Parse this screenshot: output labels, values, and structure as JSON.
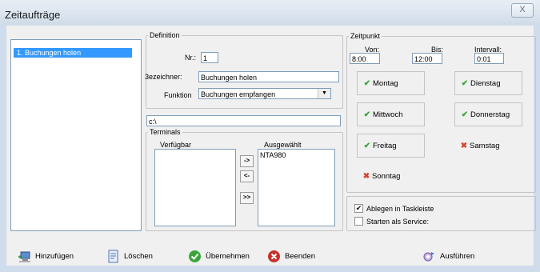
{
  "window": {
    "title": "Zeitaufträge",
    "close_label": "X"
  },
  "jobs_list": {
    "items": [
      "1. Buchungen holen"
    ]
  },
  "definition": {
    "legend": "Definition",
    "nr_label": "Nr.:",
    "nr_value": "1",
    "bezeichner_label": "3ezeichner:",
    "bezeichner_value": "Buchungen holen",
    "funktion_label": "Funktion",
    "funktion_value": "Buchungen empfangen",
    "combo_arrow": "▼"
  },
  "path": {
    "value": "c:\\"
  },
  "terminals": {
    "legend": "Terminals",
    "available_header": "Verfügbar",
    "selected_header": "Ausgewählt",
    "selected_items": [
      "NTA980"
    ],
    "btn_add": "->",
    "btn_remove": "<-",
    "btn_add_all": ">>"
  },
  "zeitpunkt": {
    "legend": "Zeitpunkt",
    "von_label": "Von:",
    "von_value": "8:00",
    "bis_label": "Bis:",
    "bis_value": "12:00",
    "intervall_label": "Intervall:",
    "intervall_value": "0:01",
    "check_mark": "✔",
    "cross_mark": "✖",
    "days": {
      "montag": {
        "label": "Montag",
        "active": true
      },
      "dienstag": {
        "label": "Dienstag",
        "active": true
      },
      "mittwoch": {
        "label": "Mittwoch",
        "active": true
      },
      "donnerstag": {
        "label": "Donnerstag",
        "active": true
      },
      "freitag": {
        "label": "Freitag",
        "active": true
      },
      "samstag": {
        "label": "Samstag",
        "active": false
      },
      "sonntag": {
        "label": "Sonntag",
        "active": false
      }
    }
  },
  "options": {
    "taskleiste_label": "Ablegen in Taskleiste",
    "taskleiste_checked": true,
    "taskleiste_mark": "✔",
    "service_label": "Starten als Service:",
    "service_checked": false
  },
  "toolbar": {
    "add_label": "Hinzufügen",
    "delete_label": "Löschen",
    "apply_label": "Übernehmen",
    "exit_label": "Beenden",
    "run_label": "Ausführen"
  },
  "colors": {
    "accent": "#3399ff",
    "active_day": "#3aa53a",
    "inactive_day": "#d8442e"
  }
}
